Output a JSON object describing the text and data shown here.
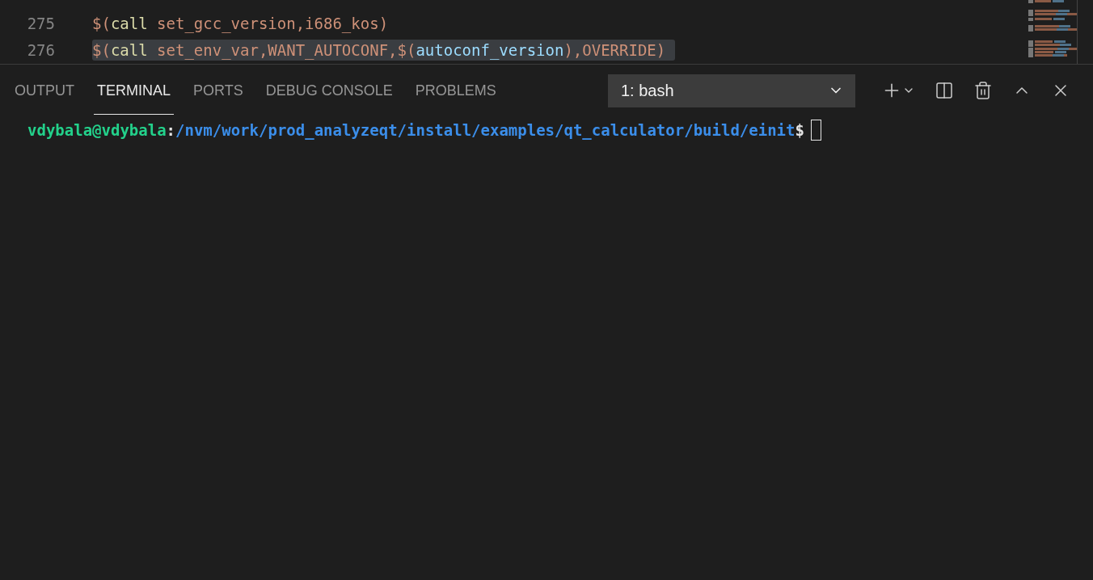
{
  "editor": {
    "lines": [
      {
        "number": "275",
        "highlighted": false,
        "tokens": [
          {
            "kind": "punct",
            "text": "$("
          },
          {
            "kind": "keyword",
            "text": "call"
          },
          {
            "kind": "punct",
            "text": " set_gcc_version,i686_kos)"
          }
        ]
      },
      {
        "number": "276",
        "highlighted": true,
        "tokens": [
          {
            "kind": "punct",
            "text": "$("
          },
          {
            "kind": "keyword",
            "text": "call"
          },
          {
            "kind": "punct",
            "text": " set_env_var,WANT_AUTOCONF,$("
          },
          {
            "kind": "variable",
            "text": "autoconf_version"
          },
          {
            "kind": "punct",
            "text": "),OVERRIDE)"
          }
        ]
      }
    ]
  },
  "panel": {
    "tabs": [
      {
        "label": "OUTPUT",
        "selected": false
      },
      {
        "label": "TERMINAL",
        "selected": true
      },
      {
        "label": "PORTS",
        "selected": false
      },
      {
        "label": "DEBUG CONSOLE",
        "selected": false
      },
      {
        "label": "PROBLEMS",
        "selected": false
      }
    ],
    "terminal_select": {
      "value": "1: bash"
    },
    "terminal": {
      "user": "vdybala@vdybala",
      "separator": ":",
      "path": "/nvm/work/prod_analyzeqt/install/examples/qt_calculator/build/einit",
      "prompt": "$"
    }
  }
}
